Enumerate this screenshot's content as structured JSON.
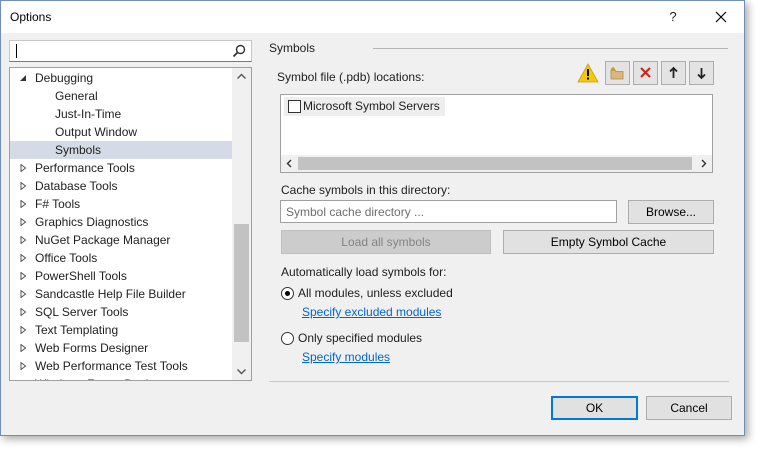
{
  "window": {
    "title": "Options",
    "help_symbol": "?"
  },
  "search": {
    "value": ""
  },
  "tree": {
    "items": [
      {
        "label": "Debugging",
        "level": 0,
        "expanded": true
      },
      {
        "label": "General",
        "level": 1
      },
      {
        "label": "Just-In-Time",
        "level": 1
      },
      {
        "label": "Output Window",
        "level": 1
      },
      {
        "label": "Symbols",
        "level": 1,
        "selected": true
      },
      {
        "label": "Performance Tools",
        "level": 0,
        "expanded": false
      },
      {
        "label": "Database Tools",
        "level": 0,
        "expanded": false
      },
      {
        "label": "F# Tools",
        "level": 0,
        "expanded": false
      },
      {
        "label": "Graphics Diagnostics",
        "level": 0,
        "expanded": false
      },
      {
        "label": "NuGet Package Manager",
        "level": 0,
        "expanded": false
      },
      {
        "label": "Office Tools",
        "level": 0,
        "expanded": false
      },
      {
        "label": "PowerShell Tools",
        "level": 0,
        "expanded": false
      },
      {
        "label": "Sandcastle Help File Builder",
        "level": 0,
        "expanded": false
      },
      {
        "label": "SQL Server Tools",
        "level": 0,
        "expanded": false
      },
      {
        "label": "Text Templating",
        "level": 0,
        "expanded": false
      },
      {
        "label": "Web Forms Designer",
        "level": 0,
        "expanded": false
      },
      {
        "label": "Web Performance Test Tools",
        "level": 0,
        "expanded": false
      },
      {
        "label": "Windows Forms Designer",
        "level": 0,
        "expanded": false
      }
    ]
  },
  "symbols": {
    "section_label": "Symbols",
    "locations_label": "Symbol file (.pdb) locations:",
    "locations": [
      {
        "label": "Microsoft Symbol Servers",
        "checked": false
      }
    ],
    "cache_label": "Cache symbols in this directory:",
    "cache_placeholder": "Symbol cache directory ...",
    "browse_label": "Browse...",
    "load_all_label": "Load all symbols",
    "empty_cache_label": "Empty Symbol Cache",
    "auto_load_label": "Automatically load symbols for:",
    "radio_all_label": "All modules, unless excluded",
    "link_excluded": "Specify excluded modules",
    "radio_only_label": "Only specified modules",
    "link_modules": "Specify modules",
    "selected_radio": "all"
  },
  "footer": {
    "ok_label": "OK",
    "cancel_label": "Cancel"
  },
  "colors": {
    "accent": "#0078d7",
    "link": "#0066cc",
    "warning": "#f2c811",
    "delete": "#c42b1c",
    "selection": "#d5dbe6"
  },
  "icons": {
    "search": "search-icon",
    "warning": "warning-icon",
    "new_folder": "new-folder-icon",
    "delete": "delete-icon",
    "move_up": "arrow-up-icon",
    "move_down": "arrow-down-icon",
    "close": "close-icon"
  }
}
